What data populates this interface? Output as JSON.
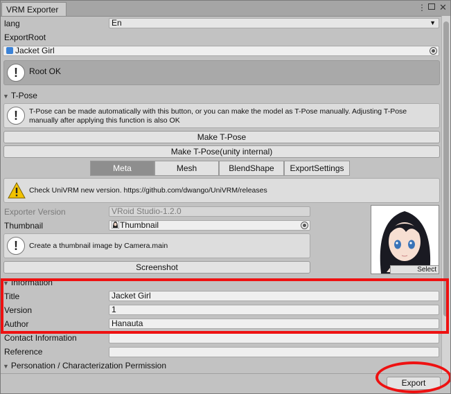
{
  "window": {
    "tab_title": "VRM Exporter"
  },
  "lang": {
    "label": "lang",
    "value": "En"
  },
  "export_root": {
    "label": "ExportRoot",
    "value": "Jacket Girl"
  },
  "root_status": {
    "text": "Root OK"
  },
  "tpose": {
    "header": "T-Pose",
    "help": "T-Pose can be made automatically with this button, or you can make the model as T-Pose manually. Adjusting T-Pose manually after applying this function is also OK",
    "make_button": "Make T-Pose",
    "make_internal_button": "Make T-Pose(unity internal)"
  },
  "tabs": [
    {
      "label": "Meta",
      "active": true
    },
    {
      "label": "Mesh",
      "active": false
    },
    {
      "label": "BlendShape",
      "active": false
    },
    {
      "label": "ExportSettings",
      "active": false
    }
  ],
  "version_warning": {
    "text": "Check UniVRM new version. https://github.com/dwango/UniVRM/releases"
  },
  "meta": {
    "exporter_version_label": "Exporter Version",
    "exporter_version_value": "VRoid Studio-1.2.0",
    "thumbnail_label": "Thumbnail",
    "thumbnail_value": "Thumbnail",
    "thumbnail_help": "Create a thumbnail image by Camera.main",
    "screenshot_button": "Screenshot",
    "select_button": "Select"
  },
  "information": {
    "header": "Information",
    "title_label": "Title",
    "title_value": "Jacket Girl",
    "version_label": "Version",
    "version_value": "1",
    "author_label": "Author",
    "author_value": "Hanauta",
    "contact_label": "Contact Information",
    "contact_value": "",
    "reference_label": "Reference",
    "reference_value": ""
  },
  "permission": {
    "header": "Personation / Characterization Permission"
  },
  "footer": {
    "export_button": "Export"
  },
  "colors": {
    "annotation_red": "#ee1111",
    "active_tab": "#8e8e8e",
    "warning_yellow": "#f2c200"
  }
}
